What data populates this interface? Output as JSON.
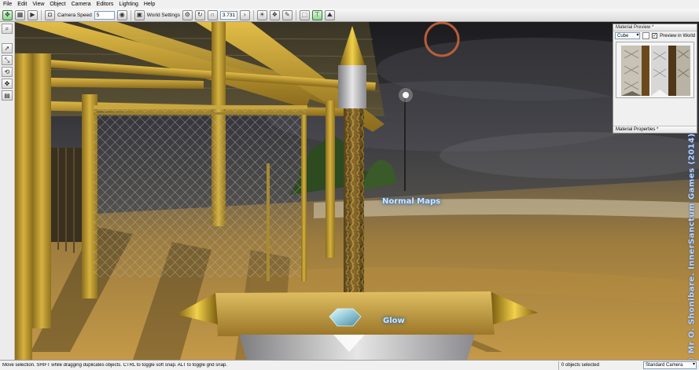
{
  "menu": [
    "File",
    "Edit",
    "View",
    "Object",
    "Camera",
    "Editors",
    "Lighting",
    "Help"
  ],
  "toolbar": {
    "camera_speed_label": "Camera Speed",
    "camera_speed_value": "5",
    "world_settings_label": "World Settings",
    "snap_value": "3.731"
  },
  "viewport": {
    "label_normal_maps": "Normal Maps",
    "label_glow": "Glow",
    "watermark": "© Mr O. Shonibare. InnerSanctum Games (2014)"
  },
  "material_panel": {
    "preview_title": "Material Preview *",
    "shape_value": "Cube",
    "preview_in_world_label": "Preview in World",
    "preview_in_world_checked": true,
    "properties_title": "Material Properties *"
  },
  "status": {
    "message": "Move selection. SHIFT while dragging duplicates objects.  CTRL to toggle soft snap.  ALT to toggle grid snap.",
    "objects_selected": "0 objects selected",
    "camera": "Standard Camera"
  },
  "icons": {
    "toolbar": [
      "move-mode-icon",
      "grid-icon",
      "play-icon",
      "camera-icon",
      "eye-icon",
      "world-icon",
      "snap-icon",
      "magnet-icon",
      "lights-icon",
      "render-icon",
      "select-icon",
      "terrain-icon"
    ],
    "left": [
      "zoom-icon",
      "pointer-icon",
      "scale-icon",
      "rotate-icon",
      "transform-icon"
    ]
  },
  "colors": {
    "sky": "#2a2a2e",
    "sand": "#a8823c",
    "wood": "#c9a43a",
    "label_glow": "#cfe6ff"
  }
}
